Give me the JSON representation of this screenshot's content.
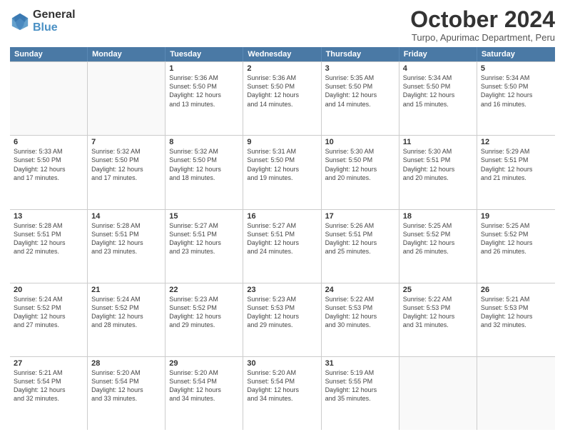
{
  "logo": {
    "line1": "General",
    "line2": "Blue"
  },
  "header": {
    "month": "October 2024",
    "location": "Turpo, Apurimac Department, Peru"
  },
  "days_of_week": [
    "Sunday",
    "Monday",
    "Tuesday",
    "Wednesday",
    "Thursday",
    "Friday",
    "Saturday"
  ],
  "weeks": [
    [
      {
        "day": "",
        "info": "",
        "empty": true
      },
      {
        "day": "",
        "info": "",
        "empty": true
      },
      {
        "day": "1",
        "info": "Sunrise: 5:36 AM\nSunset: 5:50 PM\nDaylight: 12 hours\nand 13 minutes."
      },
      {
        "day": "2",
        "info": "Sunrise: 5:36 AM\nSunset: 5:50 PM\nDaylight: 12 hours\nand 14 minutes."
      },
      {
        "day": "3",
        "info": "Sunrise: 5:35 AM\nSunset: 5:50 PM\nDaylight: 12 hours\nand 14 minutes."
      },
      {
        "day": "4",
        "info": "Sunrise: 5:34 AM\nSunset: 5:50 PM\nDaylight: 12 hours\nand 15 minutes."
      },
      {
        "day": "5",
        "info": "Sunrise: 5:34 AM\nSunset: 5:50 PM\nDaylight: 12 hours\nand 16 minutes."
      }
    ],
    [
      {
        "day": "6",
        "info": "Sunrise: 5:33 AM\nSunset: 5:50 PM\nDaylight: 12 hours\nand 17 minutes."
      },
      {
        "day": "7",
        "info": "Sunrise: 5:32 AM\nSunset: 5:50 PM\nDaylight: 12 hours\nand 17 minutes."
      },
      {
        "day": "8",
        "info": "Sunrise: 5:32 AM\nSunset: 5:50 PM\nDaylight: 12 hours\nand 18 minutes."
      },
      {
        "day": "9",
        "info": "Sunrise: 5:31 AM\nSunset: 5:50 PM\nDaylight: 12 hours\nand 19 minutes."
      },
      {
        "day": "10",
        "info": "Sunrise: 5:30 AM\nSunset: 5:50 PM\nDaylight: 12 hours\nand 20 minutes."
      },
      {
        "day": "11",
        "info": "Sunrise: 5:30 AM\nSunset: 5:51 PM\nDaylight: 12 hours\nand 20 minutes."
      },
      {
        "day": "12",
        "info": "Sunrise: 5:29 AM\nSunset: 5:51 PM\nDaylight: 12 hours\nand 21 minutes."
      }
    ],
    [
      {
        "day": "13",
        "info": "Sunrise: 5:28 AM\nSunset: 5:51 PM\nDaylight: 12 hours\nand 22 minutes."
      },
      {
        "day": "14",
        "info": "Sunrise: 5:28 AM\nSunset: 5:51 PM\nDaylight: 12 hours\nand 23 minutes."
      },
      {
        "day": "15",
        "info": "Sunrise: 5:27 AM\nSunset: 5:51 PM\nDaylight: 12 hours\nand 23 minutes."
      },
      {
        "day": "16",
        "info": "Sunrise: 5:27 AM\nSunset: 5:51 PM\nDaylight: 12 hours\nand 24 minutes."
      },
      {
        "day": "17",
        "info": "Sunrise: 5:26 AM\nSunset: 5:51 PM\nDaylight: 12 hours\nand 25 minutes."
      },
      {
        "day": "18",
        "info": "Sunrise: 5:25 AM\nSunset: 5:52 PM\nDaylight: 12 hours\nand 26 minutes."
      },
      {
        "day": "19",
        "info": "Sunrise: 5:25 AM\nSunset: 5:52 PM\nDaylight: 12 hours\nand 26 minutes."
      }
    ],
    [
      {
        "day": "20",
        "info": "Sunrise: 5:24 AM\nSunset: 5:52 PM\nDaylight: 12 hours\nand 27 minutes."
      },
      {
        "day": "21",
        "info": "Sunrise: 5:24 AM\nSunset: 5:52 PM\nDaylight: 12 hours\nand 28 minutes."
      },
      {
        "day": "22",
        "info": "Sunrise: 5:23 AM\nSunset: 5:52 PM\nDaylight: 12 hours\nand 29 minutes."
      },
      {
        "day": "23",
        "info": "Sunrise: 5:23 AM\nSunset: 5:53 PM\nDaylight: 12 hours\nand 29 minutes."
      },
      {
        "day": "24",
        "info": "Sunrise: 5:22 AM\nSunset: 5:53 PM\nDaylight: 12 hours\nand 30 minutes."
      },
      {
        "day": "25",
        "info": "Sunrise: 5:22 AM\nSunset: 5:53 PM\nDaylight: 12 hours\nand 31 minutes."
      },
      {
        "day": "26",
        "info": "Sunrise: 5:21 AM\nSunset: 5:53 PM\nDaylight: 12 hours\nand 32 minutes."
      }
    ],
    [
      {
        "day": "27",
        "info": "Sunrise: 5:21 AM\nSunset: 5:54 PM\nDaylight: 12 hours\nand 32 minutes."
      },
      {
        "day": "28",
        "info": "Sunrise: 5:20 AM\nSunset: 5:54 PM\nDaylight: 12 hours\nand 33 minutes."
      },
      {
        "day": "29",
        "info": "Sunrise: 5:20 AM\nSunset: 5:54 PM\nDaylight: 12 hours\nand 34 minutes."
      },
      {
        "day": "30",
        "info": "Sunrise: 5:20 AM\nSunset: 5:54 PM\nDaylight: 12 hours\nand 34 minutes."
      },
      {
        "day": "31",
        "info": "Sunrise: 5:19 AM\nSunset: 5:55 PM\nDaylight: 12 hours\nand 35 minutes."
      },
      {
        "day": "",
        "info": "",
        "empty": true
      },
      {
        "day": "",
        "info": "",
        "empty": true
      }
    ]
  ]
}
